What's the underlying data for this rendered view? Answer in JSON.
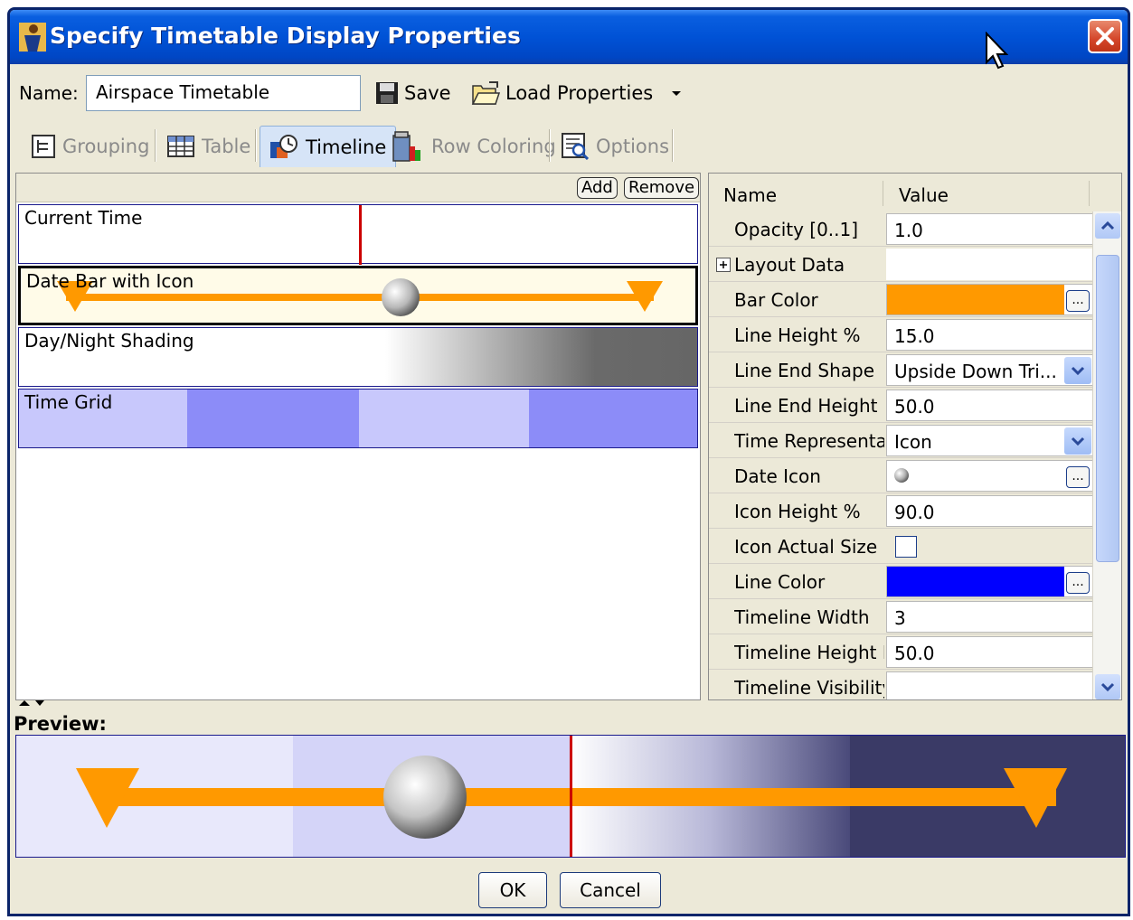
{
  "window": {
    "title": "Specify Timetable Display Properties"
  },
  "toolbar": {
    "name_label": "Name:",
    "name_value": "Airspace Timetable",
    "save_label": "Save",
    "load_label": "Load Properties"
  },
  "tabs": [
    {
      "label": "Grouping",
      "icon": "grouping-icon",
      "active": false
    },
    {
      "label": "Table",
      "icon": "table-icon",
      "active": false
    },
    {
      "label": "Timeline",
      "icon": "timeline-icon",
      "active": true
    },
    {
      "label": "Row Coloring",
      "icon": "row-coloring-icon",
      "active": false
    },
    {
      "label": "Options",
      "icon": "options-icon",
      "active": false
    }
  ],
  "layers_panel": {
    "add_label": "Add",
    "remove_label": "Remove",
    "layers": [
      {
        "label": "Current Time"
      },
      {
        "label": "Date Bar with Icon",
        "selected": true
      },
      {
        "label": "Day/Night Shading"
      },
      {
        "label": "Time Grid"
      }
    ]
  },
  "properties": {
    "header_name": "Name",
    "header_value": "Value",
    "rows": [
      {
        "name": "Opacity [0..1]",
        "value": "1.0"
      },
      {
        "name": "Layout Data",
        "value": ""
      },
      {
        "name": "Bar Color",
        "value": ""
      },
      {
        "name": "Line Height %",
        "value": "15.0"
      },
      {
        "name": "Line End Shape",
        "value": "Upside Down Tri..."
      },
      {
        "name": "Line End Height %",
        "value": "50.0"
      },
      {
        "name": "Time Representat",
        "value": "Icon"
      },
      {
        "name": "Date Icon",
        "value": ""
      },
      {
        "name": "Icon Height %",
        "value": "90.0"
      },
      {
        "name": "Icon Actual Size",
        "value": ""
      },
      {
        "name": "Line Color",
        "value": ""
      },
      {
        "name": "Timeline Width",
        "value": "3"
      },
      {
        "name": "Timeline Height Pe",
        "value": "50.0"
      },
      {
        "name": "Timeline Visibility .",
        "value": ""
      }
    ]
  },
  "colors": {
    "bar_color": "#ff9900",
    "line_color": "#0000ff",
    "current_time_line": "#cc0000"
  },
  "preview": {
    "label": "Preview:"
  },
  "footer": {
    "ok_label": "OK",
    "cancel_label": "Cancel"
  }
}
